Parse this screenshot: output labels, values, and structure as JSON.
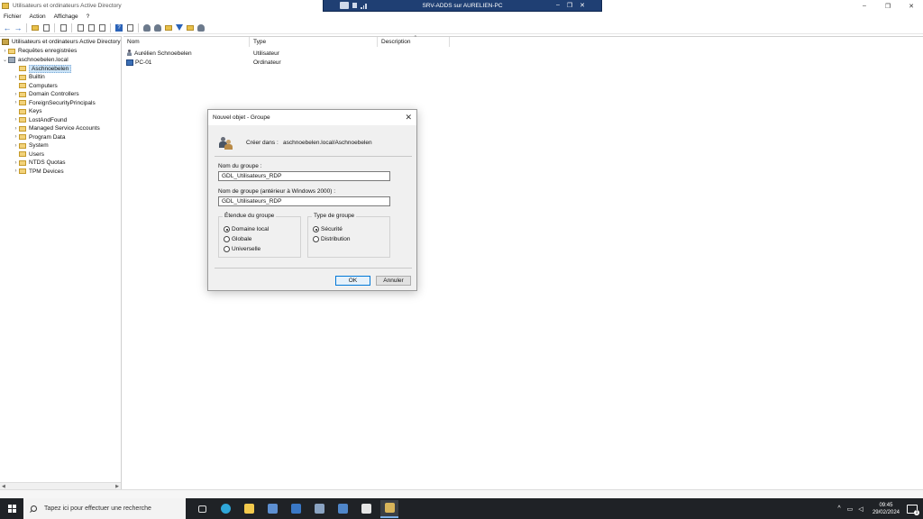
{
  "window": {
    "title": "Utilisateurs et ordinateurs Active Directory",
    "minimize": "–",
    "maximize": "❐",
    "close": "✕"
  },
  "rdp_bar": {
    "title": "SRV-ADDS sur AURELIEN-PC",
    "minimize": "–",
    "restore": "❐",
    "close": "✕"
  },
  "menu": [
    "Fichier",
    "Action",
    "Affichage",
    "?"
  ],
  "tree": {
    "root": "Utilisateurs et ordinateurs Active Directory",
    "saved_queries": "Requêtes enregistrées",
    "domain": "aschnoebelen.local",
    "items": [
      {
        "label": "Aschnoebelen",
        "selected": true
      },
      {
        "label": "Builtin"
      },
      {
        "label": "Computers"
      },
      {
        "label": "Domain Controllers"
      },
      {
        "label": "ForeignSecurityPrincipals"
      },
      {
        "label": "Keys"
      },
      {
        "label": "LostAndFound"
      },
      {
        "label": "Managed Service Accounts"
      },
      {
        "label": "Program Data"
      },
      {
        "label": "System"
      },
      {
        "label": "Users"
      },
      {
        "label": "NTDS Quotas"
      },
      {
        "label": "TPM Devices"
      }
    ]
  },
  "list": {
    "headers": [
      "Nom",
      "Type",
      "Description"
    ],
    "rows": [
      {
        "name": "Aurélien Schnoebelen",
        "type": "Utilisateur",
        "icon": "user-icon"
      },
      {
        "name": "PC-01",
        "type": "Ordinateur",
        "icon": "computer-icon"
      }
    ]
  },
  "dialog": {
    "title": "Nouvel objet - Groupe",
    "create_in_label": "Créer dans :",
    "create_in_value": "aschnoebelen.local/Aschnoebelen",
    "group_name_label": "Nom du groupe :",
    "group_name_value": "GDL_Utilisateurs_RDP",
    "group_name_pre2000_label": "Nom de groupe (antérieur à Windows 2000) :",
    "group_name_pre2000_value": "GDL_Utilisateurs_RDP",
    "scope": {
      "legend": "Étendue du groupe",
      "options": [
        "Domaine local",
        "Globale",
        "Universelle"
      ],
      "selected": "Domaine local"
    },
    "type": {
      "legend": "Type de groupe",
      "options": [
        "Sécurité",
        "Distribution"
      ],
      "selected": "Sécurité"
    },
    "ok": "OK",
    "cancel": "Annuler"
  },
  "taskbar": {
    "search_placeholder": "Tapez ici pour effectuer une recherche",
    "time": "09:45",
    "date": "29/02/2024",
    "notification_count": "1",
    "tray_chevron": "^"
  },
  "colors": {
    "rdp_bar": "#1f3f73",
    "selection": "#cce4f7",
    "taskbar": "#1f2226"
  }
}
